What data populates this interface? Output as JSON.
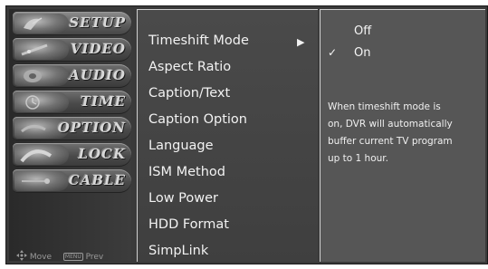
{
  "sidebar": {
    "items": [
      {
        "label": "SETUP",
        "icon": "satellite-dish-icon"
      },
      {
        "label": "VIDEO",
        "icon": "video-icon"
      },
      {
        "label": "AUDIO",
        "icon": "speaker-icon"
      },
      {
        "label": "TIME",
        "icon": "clock-icon"
      },
      {
        "label": "OPTION",
        "icon": "option-icon"
      },
      {
        "label": "LOCK",
        "icon": "lock-icon"
      },
      {
        "label": "CABLE",
        "icon": "cable-icon"
      }
    ],
    "active_index": 0,
    "footer": {
      "move_label": "Move",
      "menu_key": "MENU",
      "prev_label": "Prev"
    }
  },
  "menu": {
    "items": [
      {
        "label": "Timeshift Mode",
        "has_submenu": true
      },
      {
        "label": "Aspect Ratio"
      },
      {
        "label": "Caption/Text"
      },
      {
        "label": "Caption Option"
      },
      {
        "label": "Language"
      },
      {
        "label": "ISM Method"
      },
      {
        "label": "Low Power"
      },
      {
        "label": "HDD Format"
      },
      {
        "label": "SimpLink"
      }
    ],
    "submenu_arrow": "▶"
  },
  "submenu": {
    "options": [
      {
        "label": "Off",
        "checked": false
      },
      {
        "label": "On",
        "checked": true
      }
    ],
    "check_mark": "✓",
    "help_lines": [
      "When timeshift mode is",
      "on, DVR will automatically",
      "buffer current TV program",
      "up to 1 hour."
    ]
  }
}
